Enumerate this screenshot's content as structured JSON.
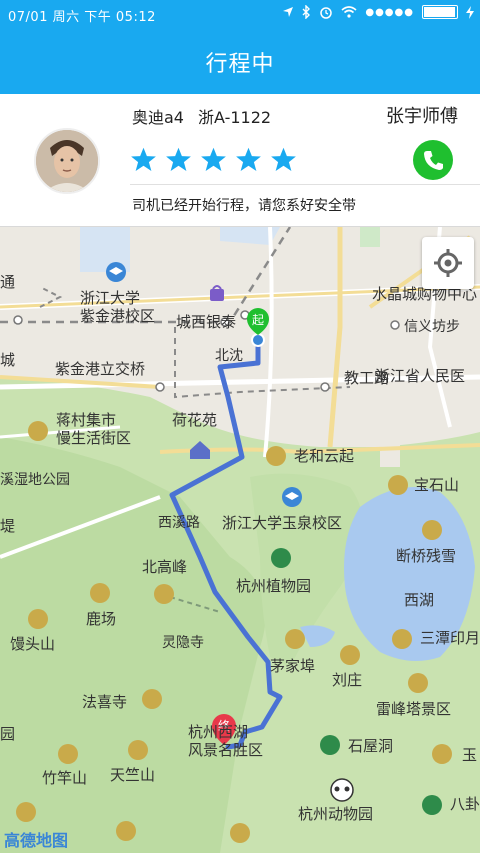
{
  "status_bar": {
    "date": "07/01",
    "weekday": "周六",
    "time": "下午 05:12",
    "signal_dots": "●●●●●"
  },
  "app_bar": {
    "title": "行程中"
  },
  "driver": {
    "car_model": "奥迪a4",
    "plate": "浙A-1122",
    "name": "张宇师傅",
    "rating_stars": 5,
    "notice": "司机已经开始行程，请您系好安全带"
  },
  "map": {
    "start_marker": "起",
    "end_marker": "终",
    "logo": "高德地图",
    "labels": {
      "zhejiang_univ_zijingang": "浙江大学\n紫金港校区",
      "chengxi_yintai": "城西银泰",
      "crystal_mall": "水晶城购物中心",
      "xinyi_fang": "信义坊步",
      "zijingang_bridge": "紫金港立交桥",
      "bei_shen": "北沈",
      "jiao_gong_lu": "教工路",
      "zj_people": "浙江省人民医",
      "jiangcun_market": "蒋村集市\n慢生活街区",
      "hehua_yuan": "荷花苑",
      "laohe_yunqi": "老和云起",
      "baoshi_shan": "宝石山",
      "wetland_park": "溪湿地公园",
      "xixi_road": "西溪路",
      "zju_yuquan": "浙江大学玉泉校区",
      "duanqiao": "断桥残雪",
      "beigaofeng": "北高峰",
      "botanical_garden": "杭州植物园",
      "xihu": "西湖",
      "lu_chang": "鹿场",
      "lingyin_si": "灵隐寺",
      "santan_yinyue": "三潭印月",
      "mantou_shan": "馒头山",
      "maojia_bu": "茅家埠",
      "liu_zhuang": "刘庄",
      "faxi_si": "法喜寺",
      "leifeng_ta": "雷峰塔景区",
      "west_lake_scenic": "杭州西湖\n风景名胜区",
      "shiwu_dong": "石屋洞",
      "yu_huang": "玉",
      "zhugan_shan": "竹竿山",
      "tianzhu_shan": "天竺山",
      "hangzhou_zoo": "杭州动物园",
      "ba_pan": "八卦",
      "cheng": "城",
      "tong": "通",
      "ti": "堤",
      "yuan": "园"
    }
  },
  "colors": {
    "primary": "#19a9f0",
    "star": "#19a9f0",
    "call": "#1fbf2f",
    "route": "#4a72d4",
    "start_marker": "#1fbf2f",
    "end_marker": "#e8394a"
  }
}
